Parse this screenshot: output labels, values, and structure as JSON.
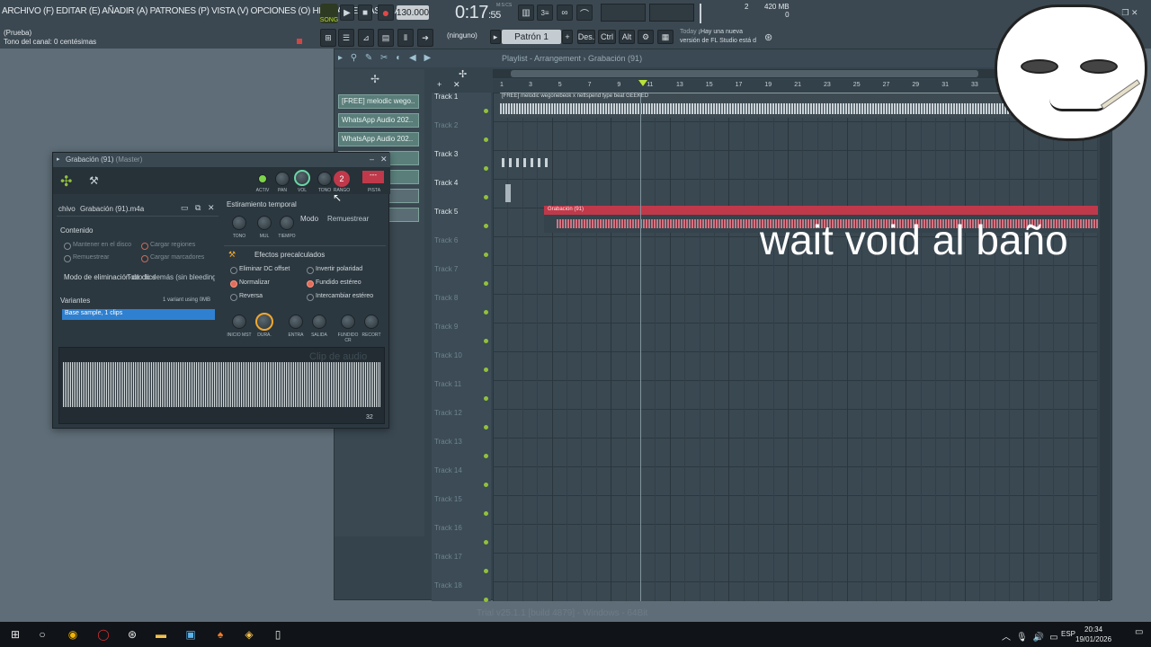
{
  "menu": {
    "items": "ARCHIVO (F)  EDITAR (E)  AÑADIR (A)  PATRONES (P)  VISTA (V)  OPCIONES (O)  HERRAMIENTAS (T)  AYUDA"
  },
  "transport": {
    "song_label": "SONG",
    "tempo": "130.000",
    "time": "0:17",
    "time_small": ":55",
    "time_unit": "M:S:CS",
    "cpu": "2",
    "memory": "420 MB",
    "polyphony": "0"
  },
  "hints": {
    "line1": "(Prueba)",
    "line2": "Tono del canal: 0 centésimas"
  },
  "toolbar": {
    "none_label": "(ninguno)",
    "pattern": "Patrón 1",
    "des": "Des.",
    "ctrl": "Ctrl",
    "alt": "Alt",
    "news_title": "Today",
    "news_line1": "¡Hay una nueva",
    "news_line2": "versión de FL Studio está d"
  },
  "playlist": {
    "title": "Playlist - Arrangement › Grabación (91)",
    "ruler": [
      "3",
      "5",
      "7",
      "9",
      "11",
      "13",
      "15",
      "17",
      "19",
      "21",
      "23",
      "25",
      "27",
      "29",
      "31",
      "33"
    ],
    "ruler_first": "1",
    "tracks": [
      "Track 1",
      "Track 2",
      "Track 3",
      "Track 4",
      "Track 5",
      "Track 6",
      "Track 7",
      "Track 8",
      "Track 9",
      "Track 10",
      "Track 11",
      "Track 12",
      "Track 13",
      "Track 14",
      "Track 15",
      "Track 16",
      "Track 17",
      "Track 18"
    ],
    "clip1_label": "[FREE] melodic wegonebeok x nettspend type beat GEEKED",
    "clip5_label": "Grabación (91)"
  },
  "browser": {
    "items": [
      "[FREE] melodic wego..",
      "WhatsApp Audio 202..",
      "WhatsApp Audio 202..",
      "..ct..",
      "..ct..",
      "",
      ""
    ]
  },
  "clip_window": {
    "title": "Grabación (91)",
    "title_suffix": "(Master)",
    "file_label": "chivo",
    "file_name": "Grabación (91).m4a",
    "knobs": [
      "ACTIV",
      "PAN",
      "VOL",
      "TONO",
      "RANGO",
      "PISTA"
    ],
    "range_value": "2",
    "stretch_title": "Estiramiento temporal",
    "stretch_knobs": [
      "TONO",
      "MUL",
      "TIEMPO"
    ],
    "mode_label": "Modo",
    "mode_value": "Remuestrear",
    "content_title": "Contenido",
    "opt_keep": "Mantener en el disco",
    "opt_regions": "Cargar regiones",
    "opt_resample": "Remuestrear",
    "opt_markers": "Cargar marcadores",
    "declick_label": "Modo de eliminación de clics",
    "declick_value": "Todo lo demás (sin bleeding)",
    "variants_title": "Variantes",
    "variants_info": "1 variant using 0MB",
    "variant_item": "Base sample, 1 clips",
    "precalc_title": "Efectos precalculados",
    "fx_dc": "Eliminar DC offset",
    "fx_invert": "Invertir polaridad",
    "fx_normalize": "Normalizar",
    "fx_fade_stereo": "Fundido estéreo",
    "fx_reverse": "Reversa",
    "fx_swap": "Intercambiar estéreo",
    "fx_knobs": [
      "INICIO MST",
      "DURA.",
      "ENTRA",
      "SALIDA",
      "FUNDIDO CR",
      "RECORT"
    ],
    "wave_caption": "Clip de audio",
    "wave_counter": "32"
  },
  "footer": "Trial v25.1.1 [build 4879] - Windows - 64Bit",
  "overlay_text": "wait void al baño",
  "taskbar": {
    "lang": "ESP",
    "time": "20:34",
    "date": "19/01/2026"
  },
  "colors": {
    "accent_green": "#92c13b",
    "recording_red": "#c0394a",
    "orange_knob": "#f0a830"
  }
}
